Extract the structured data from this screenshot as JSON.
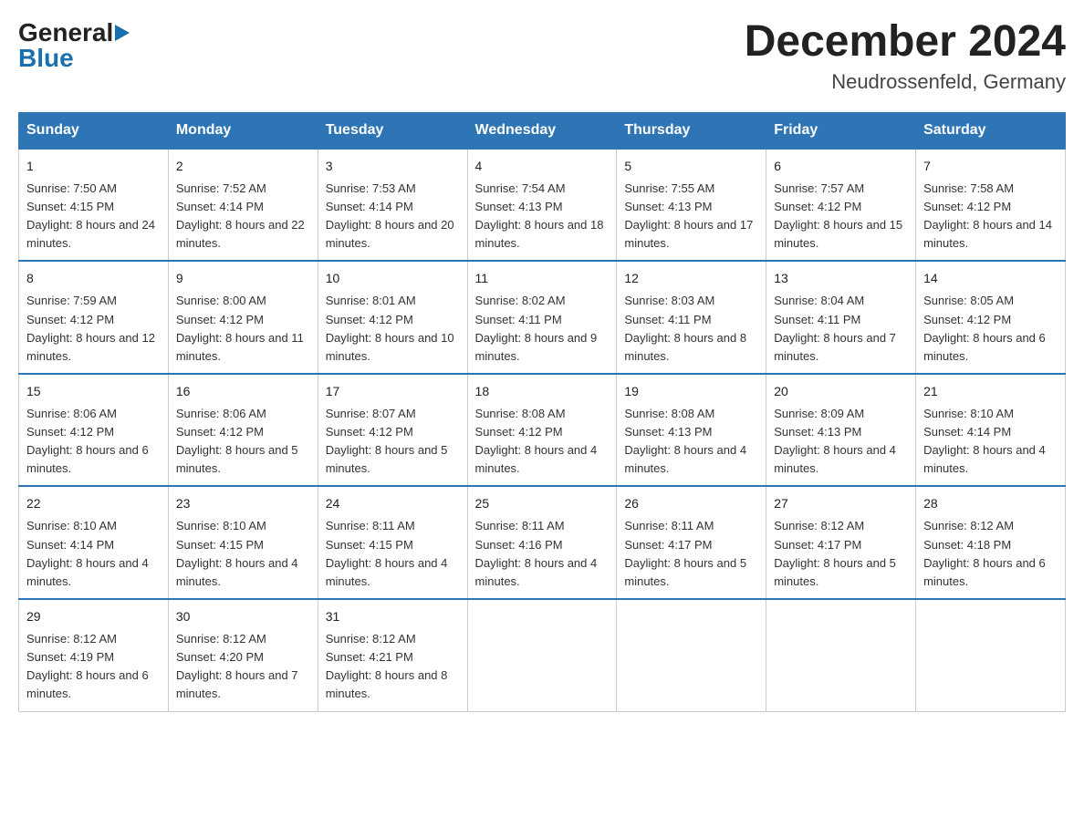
{
  "header": {
    "logo_general": "General",
    "logo_blue": "Blue",
    "month_title": "December 2024",
    "location": "Neudrossenfeld, Germany"
  },
  "columns": [
    "Sunday",
    "Monday",
    "Tuesday",
    "Wednesday",
    "Thursday",
    "Friday",
    "Saturday"
  ],
  "weeks": [
    [
      {
        "day": "1",
        "sunrise": "Sunrise: 7:50 AM",
        "sunset": "Sunset: 4:15 PM",
        "daylight": "Daylight: 8 hours and 24 minutes."
      },
      {
        "day": "2",
        "sunrise": "Sunrise: 7:52 AM",
        "sunset": "Sunset: 4:14 PM",
        "daylight": "Daylight: 8 hours and 22 minutes."
      },
      {
        "day": "3",
        "sunrise": "Sunrise: 7:53 AM",
        "sunset": "Sunset: 4:14 PM",
        "daylight": "Daylight: 8 hours and 20 minutes."
      },
      {
        "day": "4",
        "sunrise": "Sunrise: 7:54 AM",
        "sunset": "Sunset: 4:13 PM",
        "daylight": "Daylight: 8 hours and 18 minutes."
      },
      {
        "day": "5",
        "sunrise": "Sunrise: 7:55 AM",
        "sunset": "Sunset: 4:13 PM",
        "daylight": "Daylight: 8 hours and 17 minutes."
      },
      {
        "day": "6",
        "sunrise": "Sunrise: 7:57 AM",
        "sunset": "Sunset: 4:12 PM",
        "daylight": "Daylight: 8 hours and 15 minutes."
      },
      {
        "day": "7",
        "sunrise": "Sunrise: 7:58 AM",
        "sunset": "Sunset: 4:12 PM",
        "daylight": "Daylight: 8 hours and 14 minutes."
      }
    ],
    [
      {
        "day": "8",
        "sunrise": "Sunrise: 7:59 AM",
        "sunset": "Sunset: 4:12 PM",
        "daylight": "Daylight: 8 hours and 12 minutes."
      },
      {
        "day": "9",
        "sunrise": "Sunrise: 8:00 AM",
        "sunset": "Sunset: 4:12 PM",
        "daylight": "Daylight: 8 hours and 11 minutes."
      },
      {
        "day": "10",
        "sunrise": "Sunrise: 8:01 AM",
        "sunset": "Sunset: 4:12 PM",
        "daylight": "Daylight: 8 hours and 10 minutes."
      },
      {
        "day": "11",
        "sunrise": "Sunrise: 8:02 AM",
        "sunset": "Sunset: 4:11 PM",
        "daylight": "Daylight: 8 hours and 9 minutes."
      },
      {
        "day": "12",
        "sunrise": "Sunrise: 8:03 AM",
        "sunset": "Sunset: 4:11 PM",
        "daylight": "Daylight: 8 hours and 8 minutes."
      },
      {
        "day": "13",
        "sunrise": "Sunrise: 8:04 AM",
        "sunset": "Sunset: 4:11 PM",
        "daylight": "Daylight: 8 hours and 7 minutes."
      },
      {
        "day": "14",
        "sunrise": "Sunrise: 8:05 AM",
        "sunset": "Sunset: 4:12 PM",
        "daylight": "Daylight: 8 hours and 6 minutes."
      }
    ],
    [
      {
        "day": "15",
        "sunrise": "Sunrise: 8:06 AM",
        "sunset": "Sunset: 4:12 PM",
        "daylight": "Daylight: 8 hours and 6 minutes."
      },
      {
        "day": "16",
        "sunrise": "Sunrise: 8:06 AM",
        "sunset": "Sunset: 4:12 PM",
        "daylight": "Daylight: 8 hours and 5 minutes."
      },
      {
        "day": "17",
        "sunrise": "Sunrise: 8:07 AM",
        "sunset": "Sunset: 4:12 PM",
        "daylight": "Daylight: 8 hours and 5 minutes."
      },
      {
        "day": "18",
        "sunrise": "Sunrise: 8:08 AM",
        "sunset": "Sunset: 4:12 PM",
        "daylight": "Daylight: 8 hours and 4 minutes."
      },
      {
        "day": "19",
        "sunrise": "Sunrise: 8:08 AM",
        "sunset": "Sunset: 4:13 PM",
        "daylight": "Daylight: 8 hours and 4 minutes."
      },
      {
        "day": "20",
        "sunrise": "Sunrise: 8:09 AM",
        "sunset": "Sunset: 4:13 PM",
        "daylight": "Daylight: 8 hours and 4 minutes."
      },
      {
        "day": "21",
        "sunrise": "Sunrise: 8:10 AM",
        "sunset": "Sunset: 4:14 PM",
        "daylight": "Daylight: 8 hours and 4 minutes."
      }
    ],
    [
      {
        "day": "22",
        "sunrise": "Sunrise: 8:10 AM",
        "sunset": "Sunset: 4:14 PM",
        "daylight": "Daylight: 8 hours and 4 minutes."
      },
      {
        "day": "23",
        "sunrise": "Sunrise: 8:10 AM",
        "sunset": "Sunset: 4:15 PM",
        "daylight": "Daylight: 8 hours and 4 minutes."
      },
      {
        "day": "24",
        "sunrise": "Sunrise: 8:11 AM",
        "sunset": "Sunset: 4:15 PM",
        "daylight": "Daylight: 8 hours and 4 minutes."
      },
      {
        "day": "25",
        "sunrise": "Sunrise: 8:11 AM",
        "sunset": "Sunset: 4:16 PM",
        "daylight": "Daylight: 8 hours and 4 minutes."
      },
      {
        "day": "26",
        "sunrise": "Sunrise: 8:11 AM",
        "sunset": "Sunset: 4:17 PM",
        "daylight": "Daylight: 8 hours and 5 minutes."
      },
      {
        "day": "27",
        "sunrise": "Sunrise: 8:12 AM",
        "sunset": "Sunset: 4:17 PM",
        "daylight": "Daylight: 8 hours and 5 minutes."
      },
      {
        "day": "28",
        "sunrise": "Sunrise: 8:12 AM",
        "sunset": "Sunset: 4:18 PM",
        "daylight": "Daylight: 8 hours and 6 minutes."
      }
    ],
    [
      {
        "day": "29",
        "sunrise": "Sunrise: 8:12 AM",
        "sunset": "Sunset: 4:19 PM",
        "daylight": "Daylight: 8 hours and 6 minutes."
      },
      {
        "day": "30",
        "sunrise": "Sunrise: 8:12 AM",
        "sunset": "Sunset: 4:20 PM",
        "daylight": "Daylight: 8 hours and 7 minutes."
      },
      {
        "day": "31",
        "sunrise": "Sunrise: 8:12 AM",
        "sunset": "Sunset: 4:21 PM",
        "daylight": "Daylight: 8 hours and 8 minutes."
      },
      null,
      null,
      null,
      null
    ]
  ]
}
